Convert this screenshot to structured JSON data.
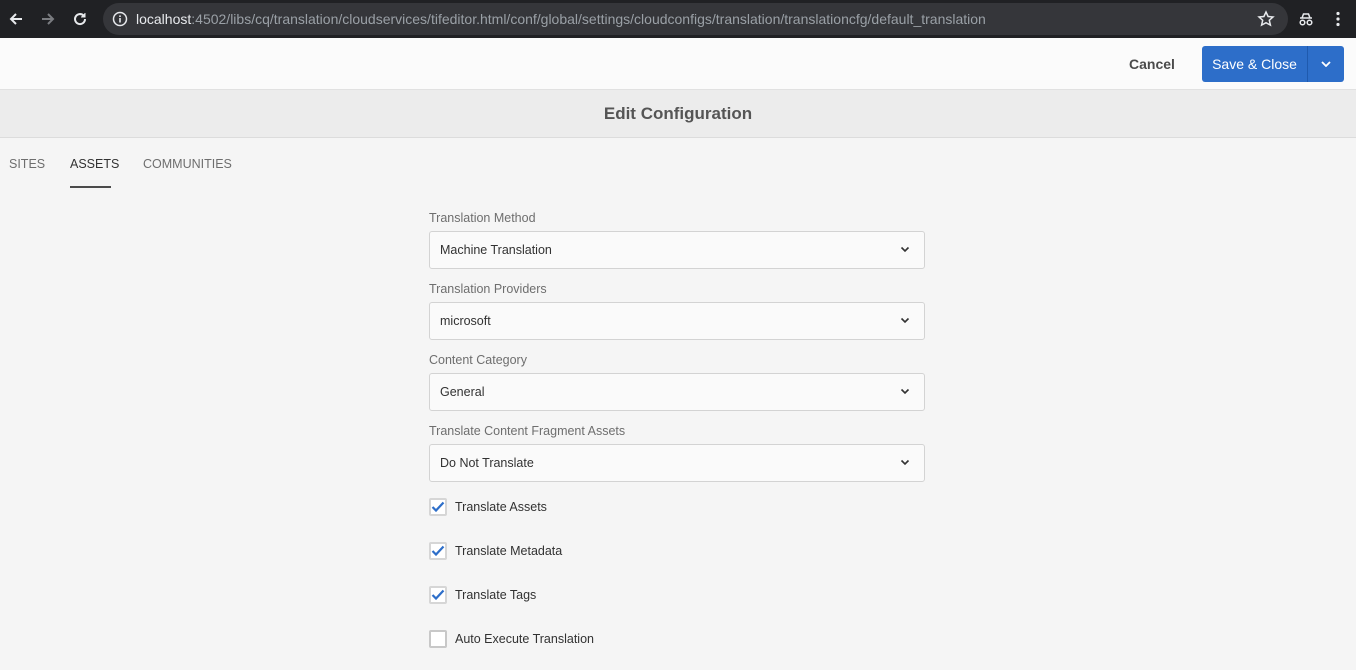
{
  "browser": {
    "url_host": "localhost",
    "url_path": ":4502/libs/cq/translation/cloudservices/tifeditor.html/conf/global/settings/cloudconfigs/translation/translationcfg/default_translation"
  },
  "toolbar": {
    "cancel_label": "Cancel",
    "save_label": "Save & Close",
    "accent_color": "#2d6ec9"
  },
  "page": {
    "title": "Edit Configuration"
  },
  "tabs": [
    {
      "label": "SITES",
      "active": false
    },
    {
      "label": "ASSETS",
      "active": true
    },
    {
      "label": "COMMUNITIES",
      "active": false
    }
  ],
  "form": {
    "translation_method": {
      "label": "Translation Method",
      "value": "Machine Translation"
    },
    "translation_providers": {
      "label": "Translation Providers",
      "value": "microsoft"
    },
    "content_category": {
      "label": "Content Category",
      "value": "General"
    },
    "content_fragment": {
      "label": "Translate Content Fragment Assets",
      "value": "Do Not Translate"
    },
    "checkboxes": [
      {
        "label": "Translate Assets",
        "checked": true
      },
      {
        "label": "Translate Metadata",
        "checked": true
      },
      {
        "label": "Translate Tags",
        "checked": true
      },
      {
        "label": "Auto Execute Translation",
        "checked": false
      }
    ],
    "check_color": "#2d6ec9"
  }
}
